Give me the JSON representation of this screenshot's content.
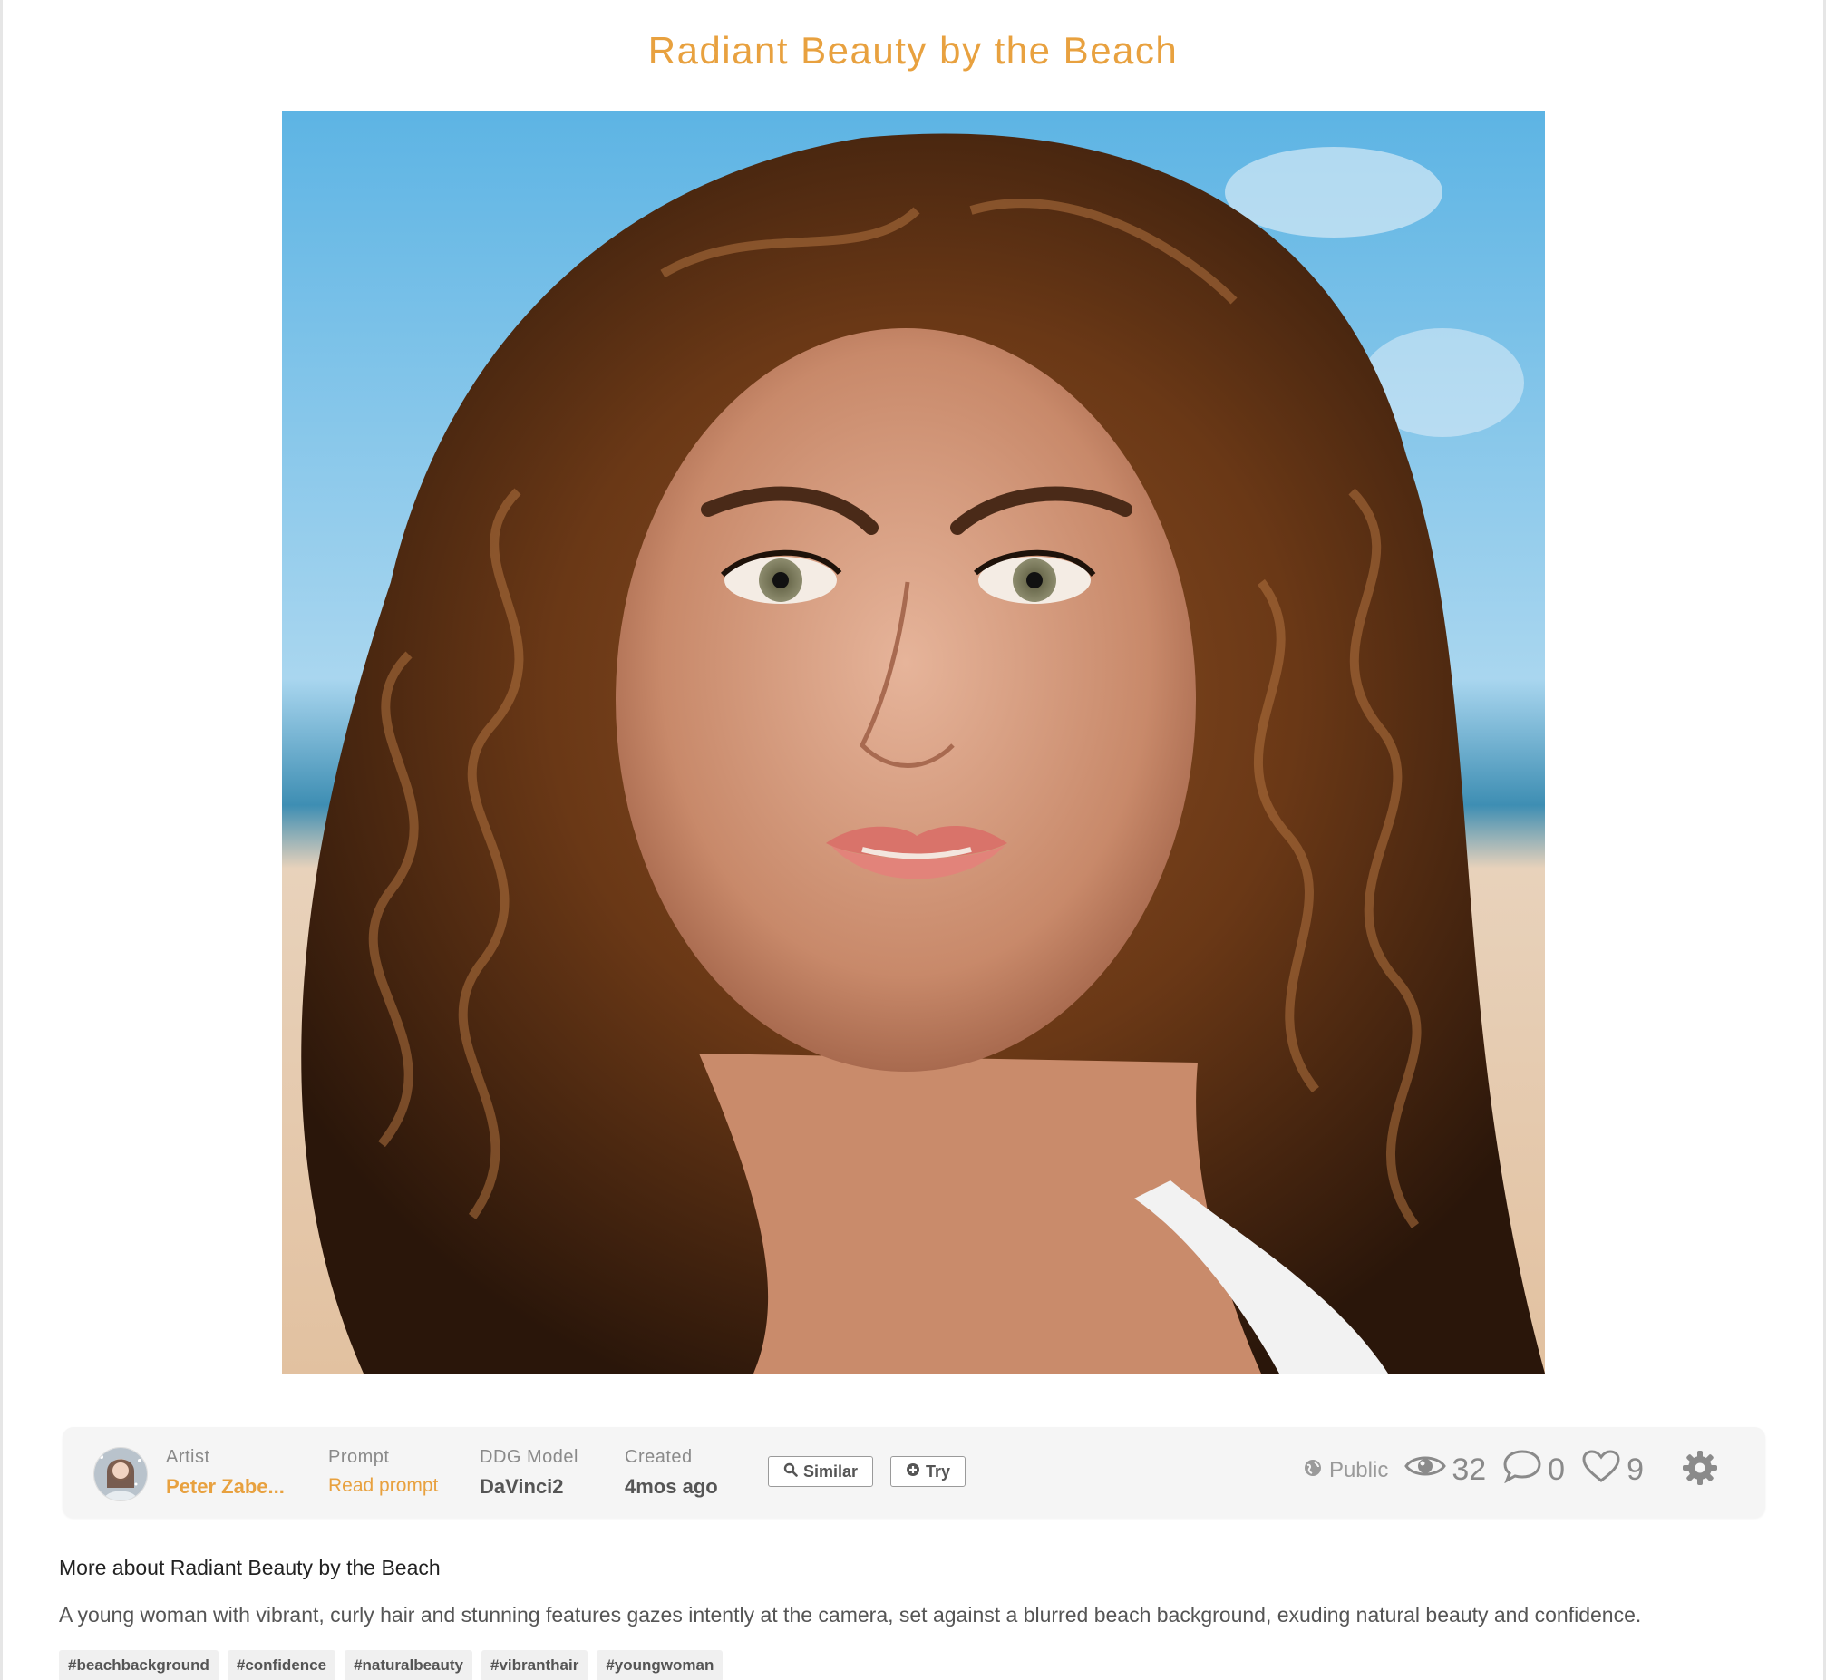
{
  "title": "Radiant Beauty by the Beach",
  "artwork": {
    "alt": "A young woman with vibrant, curly hair against a beach background"
  },
  "info": {
    "artist_label": "Artist",
    "artist_name": "Peter Zabe...",
    "prompt_label": "Prompt",
    "prompt_link": "Read prompt",
    "model_label": "DDG Model",
    "model_name": "DaVinci2",
    "created_label": "Created",
    "created_value": "4mos ago",
    "similar_button": "Similar",
    "try_button": "Try",
    "visibility": "Public",
    "views": "32",
    "comments": "0",
    "likes": "9"
  },
  "more_heading": "More about Radiant Beauty by the Beach",
  "description": "A young woman with vibrant, curly hair and stunning features gazes intently at the camera, set against a blurred beach background, exuding natural beauty and confidence.",
  "tags": [
    "#beachbackground",
    "#confidence",
    "#naturalbeauty",
    "#vibranthair",
    "#youngwoman"
  ],
  "colors": {
    "accent": "#e8a13f",
    "bar_bg": "#f5f5f5",
    "muted": "#8a8a8a"
  },
  "icons": {
    "search": "search-icon",
    "plus": "plus-circle-icon",
    "globe": "globe-icon",
    "eye": "eye-icon",
    "comment": "comment-icon",
    "heart": "heart-icon",
    "gear": "gear-icon"
  }
}
